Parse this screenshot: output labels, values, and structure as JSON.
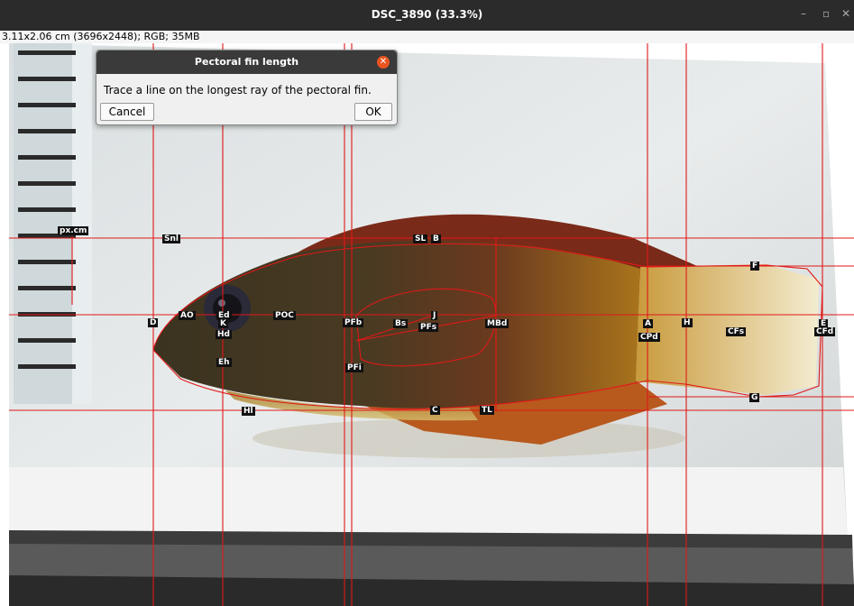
{
  "window": {
    "title": "DSC_3890 (33.3%)",
    "minimize": "–",
    "maximize": "▫",
    "close": "✕"
  },
  "info": "3.11x2.06 cm (3696x2448); RGB; 35MB",
  "dialog": {
    "title": "Pectoral fin length",
    "message": "Trace a line on the longest ray of the pectoral fin.",
    "cancel_label": "Cancel",
    "ok_label": "OK"
  },
  "landmarks": {
    "px_cm": "px.cm",
    "snl": "Snl",
    "sl": "SL",
    "b": "B",
    "f": "F",
    "e": "E",
    "d": "D",
    "ao": "AO",
    "ed": "Ed",
    "k": "K",
    "hd": "Hd",
    "poc": "POC",
    "pfb": "PFb",
    "bs": "Bs",
    "j": "J",
    "pfs": "PFs",
    "mbd": "MBd",
    "a": "A",
    "h": "H",
    "cfs": "CFs",
    "cfd": "CFd",
    "cpd": "CPd",
    "eh": "Eh",
    "pfi": "PFi",
    "hl": "Hl",
    "c": "C",
    "tl": "TL",
    "g": "G"
  },
  "colors": {
    "accent_line": "#e01818",
    "titlebar": "#2b2b2b",
    "dialog_close": "#e95420"
  }
}
